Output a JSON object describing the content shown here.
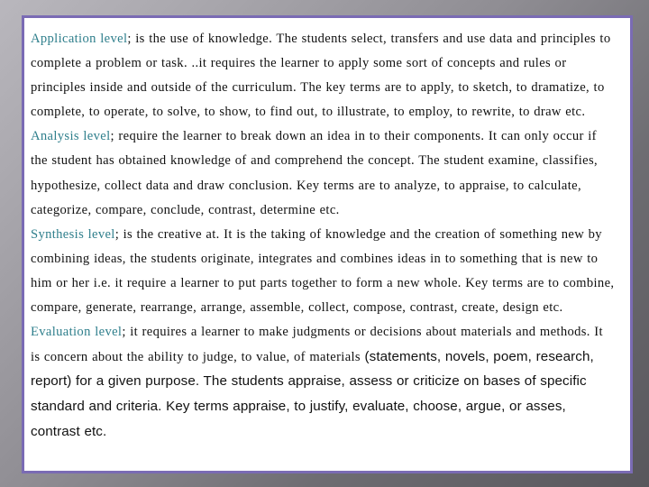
{
  "document": {
    "paragraphs": [
      {
        "heading": "Application level",
        "lines": [
          "; is the use of knowledge. The students select, transfers and use data and principles to",
          "complete a problem or task. ..it requires the learner to apply some sort of concepts and rules or",
          "principles inside and outside of the curriculum. The key terms are to apply, to sketch, to dramatize, to",
          "complete, to operate, to solve, to show, to find out, to illustrate, to employ, to rewrite, to draw etc."
        ]
      },
      {
        "heading": "Analysis level",
        "lines": [
          "; require the learner to break down an idea in to their components. It can only occur if",
          "the student has obtained knowledge of and comprehend the concept. The student examine, classifies,",
          "hypothesize, collect data and draw conclusion. Key terms are to analyze, to appraise, to calculate,",
          "categorize, compare, conclude, contrast, determine etc."
        ]
      },
      {
        "heading": "Synthesis level",
        "lines": [
          "; is the creative at. It is the taking of knowledge and the creation of something new by",
          "combining ideas, the students originate, integrates and combines ideas in to something that is new to",
          "him or her i.e. it require a learner to put parts together to form a new whole. Key terms are to combine,",
          "compare, generate, rearrange, arrange, assemble, collect, compose, contrast, create, design etc."
        ]
      },
      {
        "heading": "Evaluation level",
        "lines": [
          "; it requires a learner to make judgments or decisions about materials and methods. It",
          "is concern about the ability to judge, to value, of materials "
        ],
        "line2_sans_tail": "(statements, novels, poem, research,",
        "sans_lines": [
          "report) for a given purpose. The students appraise, assess or criticize on bases of specific",
          "standard and criteria. Key terms appraise, to justify, evaluate, choose, argue, or asses,",
          "contrast etc."
        ]
      }
    ]
  },
  "colors": {
    "heading": "#2f7f8c",
    "border": "#7a6bb4",
    "body_text": "#111111",
    "panel": "#ffffff"
  }
}
